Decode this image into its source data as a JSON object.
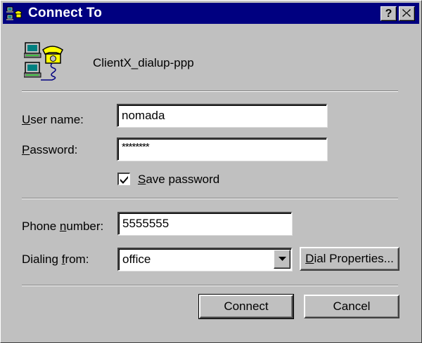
{
  "window": {
    "title": "Connect To",
    "help_glyph": "?",
    "close_glyph": "close-x",
    "title_bar_color": "#000080",
    "face_color": "#c0c0c0"
  },
  "connection": {
    "icon": "dialup-computers-phone-icon",
    "name": "ClientX_dialup-ppp"
  },
  "form": {
    "username": {
      "accel": "U",
      "label_rest": "ser name:",
      "value": "nomada"
    },
    "password": {
      "accel": "P",
      "label_rest": "assword:",
      "value": "********"
    },
    "save_password": {
      "accel": "S",
      "label_rest": "ave password",
      "checked": true
    },
    "phone": {
      "label_pre": "Phone ",
      "accel": "n",
      "label_rest": "umber:",
      "value": "5555555"
    },
    "dialing_from": {
      "label_pre": "Dialing ",
      "accel": "f",
      "label_rest": "rom:",
      "value": "office"
    }
  },
  "buttons": {
    "dial_properties": {
      "accel": "D",
      "label_rest": "ial Properties..."
    },
    "connect": "Connect",
    "cancel": "Cancel"
  }
}
